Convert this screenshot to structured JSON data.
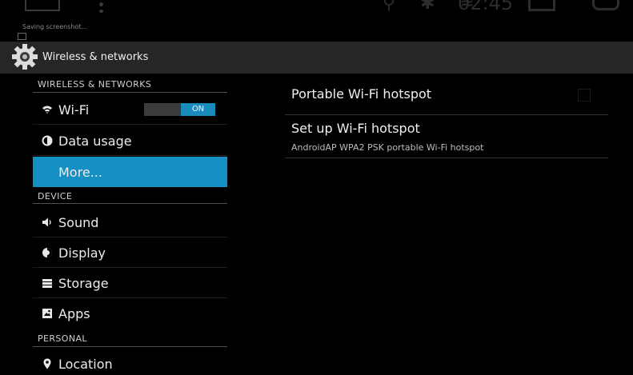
{
  "statusbar": {
    "time": "02:45",
    "toast": "Saving screenshot..."
  },
  "actionbar": {
    "title": "Wireless & networks"
  },
  "sections": {
    "wireless": "WIRELESS & NETWORKS",
    "device": "DEVICE",
    "personal": "PERSONAL"
  },
  "items": {
    "wifi": {
      "label": "Wi-Fi",
      "toggle": "ON"
    },
    "data_usage": {
      "label": "Data usage"
    },
    "more": {
      "label": "More..."
    },
    "sound": {
      "label": "Sound"
    },
    "display": {
      "label": "Display"
    },
    "storage": {
      "label": "Storage"
    },
    "apps": {
      "label": "Apps"
    },
    "location": {
      "label": "Location"
    }
  },
  "detail": {
    "hotspot_title": "Portable Wi-Fi hotspot",
    "setup_title": "Set up Wi-Fi hotspot",
    "setup_desc": "AndroidAP WPA2 PSK portable Wi-Fi hotspot"
  },
  "colors": {
    "accent": "#1590c5",
    "background": "#000000",
    "actionbar": "#262626"
  }
}
